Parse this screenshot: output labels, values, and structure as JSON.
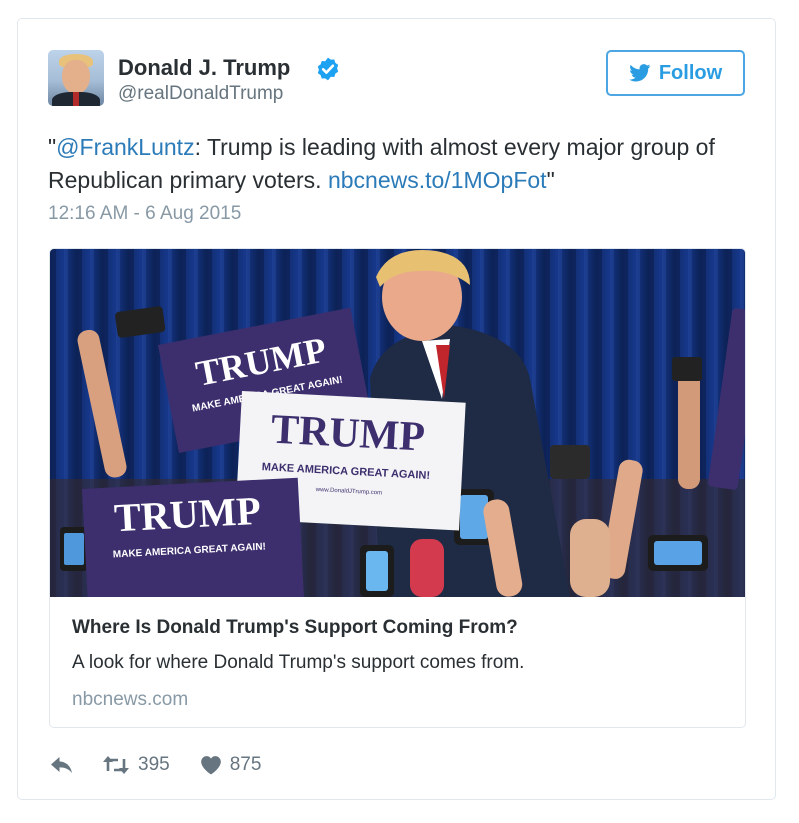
{
  "tweet": {
    "author_name": "Donald J. Trump",
    "author_handle": "@realDonaldTrump",
    "follow_label": "Follow",
    "text": {
      "open_quote": "\"",
      "mention": "@FrankLuntz",
      "body": ": Trump is leading with almost every major group of Republican primary voters. ",
      "link": "nbcnews.to/1MOpFot",
      "close_quote": "\""
    },
    "timestamp": "12:16 AM - 6 Aug 2015"
  },
  "card": {
    "title": "Where Is Donald Trump's Support Coming From?",
    "description": "A look for where Donald Trump's support comes from.",
    "domain": "nbcnews.com",
    "image": {
      "signs": [
        {
          "main": "TRUMP",
          "sub": "MAKE AMERICA GREAT AGAIN!"
        },
        {
          "main": "TRUMP",
          "sub": "MAKE AMERICA GREAT AGAIN!",
          "url": "www.DonaldJTrump.com"
        },
        {
          "main": "TRUMP",
          "sub": "MAKE AMERICA GREAT AGAIN!"
        }
      ]
    }
  },
  "actions": {
    "reply_icon": "reply-icon",
    "retweet_icon": "retweet-icon",
    "retweet_count": "395",
    "like_icon": "heart-icon",
    "like_count": "875"
  },
  "colors": {
    "link": "#2b7bb9",
    "follow_border": "#4ca6e3",
    "verified_badge": "#1da1f2",
    "muted_text": "#8899a6",
    "sign_purple": "#3d2f6e"
  }
}
